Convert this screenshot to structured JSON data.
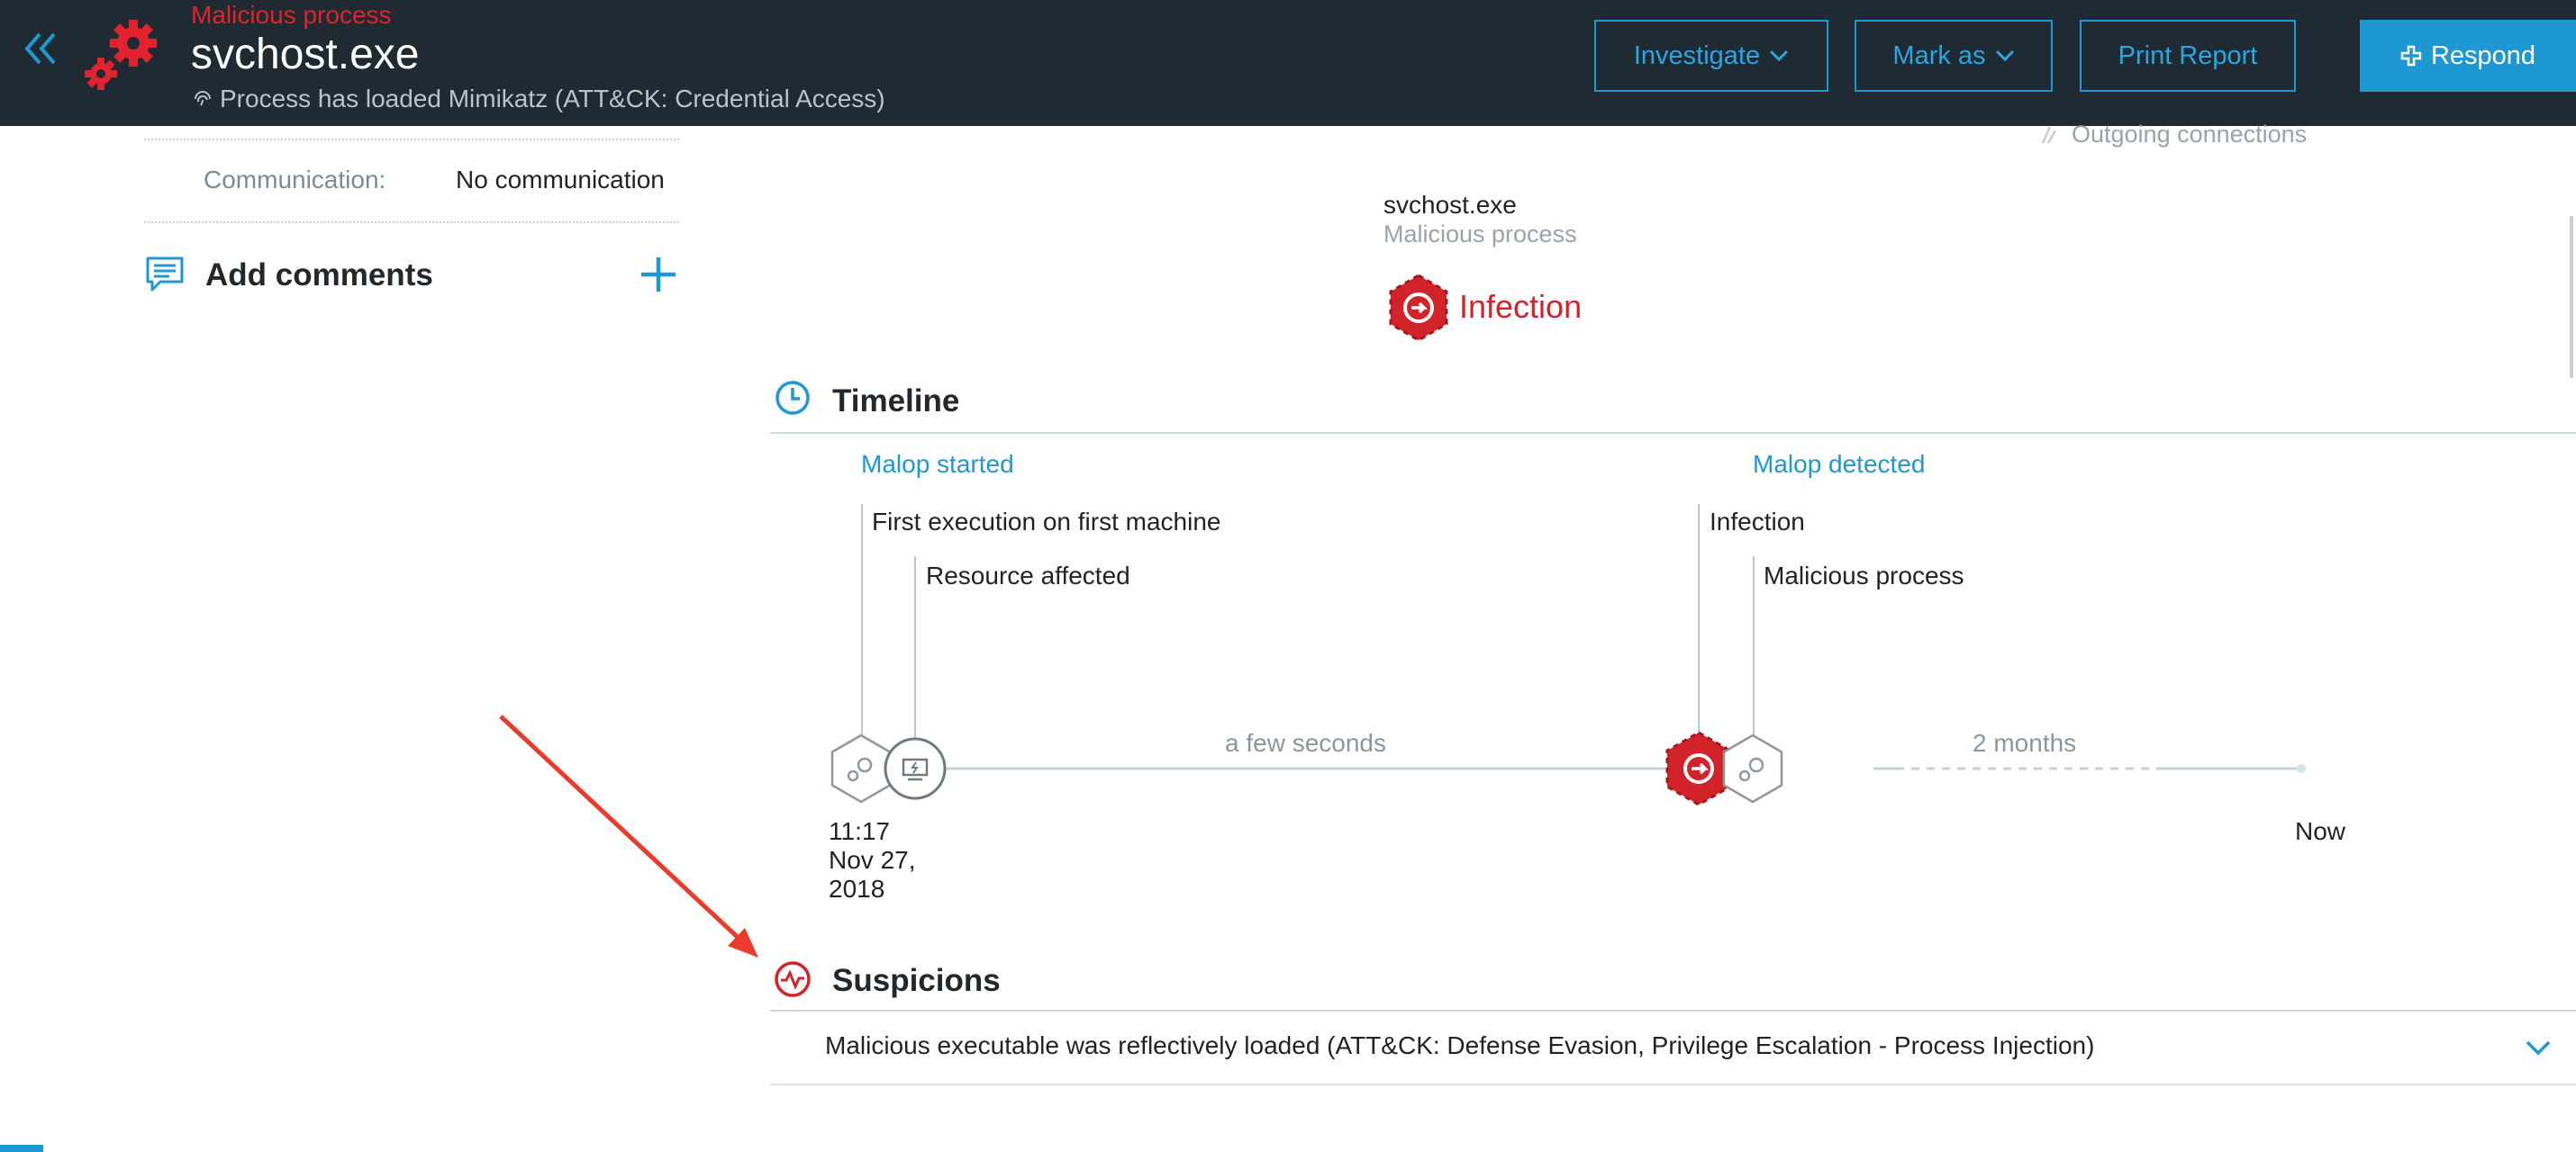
{
  "header": {
    "subtitle": "Malicious process",
    "title": "svchost.exe",
    "description": "Process has loaded Mimikatz (ATT&CK: Credential Access)",
    "buttons": {
      "investigate": "Investigate",
      "mark_as": "Mark as",
      "print_report": "Print Report",
      "respond": "Respond"
    }
  },
  "left_panel": {
    "communication_label": "Communication:",
    "communication_value": "No communication",
    "comments_title": "Add comments"
  },
  "graph": {
    "outgoing_connections": "Outgoing connections",
    "process_name": "svchost.exe",
    "process_type": "Malicious process",
    "infection_label": "Infection"
  },
  "timeline": {
    "title": "Timeline",
    "malop_started": "Malop started",
    "first_execution": "First execution on first machine",
    "resource_affected": "Resource affected",
    "malop_detected": "Malop detected",
    "infection": "Infection",
    "malicious_process": "Malicious process",
    "duration_1": "a few seconds",
    "duration_2": "2 months",
    "date_time": "11:17",
    "date_day": "Nov 27,",
    "date_year": "2018",
    "now": "Now"
  },
  "suspicions": {
    "title": "Suspicions",
    "items": [
      "Malicious executable was reflectively loaded (ATT&CK: Defense Evasion, Privilege Escalation - Process Injection)"
    ]
  },
  "colors": {
    "header_bg": "#1f2a32",
    "accent_blue": "#1d98d3",
    "malicious_red": "#d2232a"
  },
  "icons": [
    "double-chevron-left-icon",
    "gears-icon",
    "fingerprint-icon",
    "chevron-down-icon",
    "plus-icon",
    "comment-icon",
    "clock-icon",
    "pulse-icon",
    "biohazard-hex-icon",
    "gear-hex-icon",
    "monitor-circle-icon",
    "red-arrow-annotation"
  ]
}
